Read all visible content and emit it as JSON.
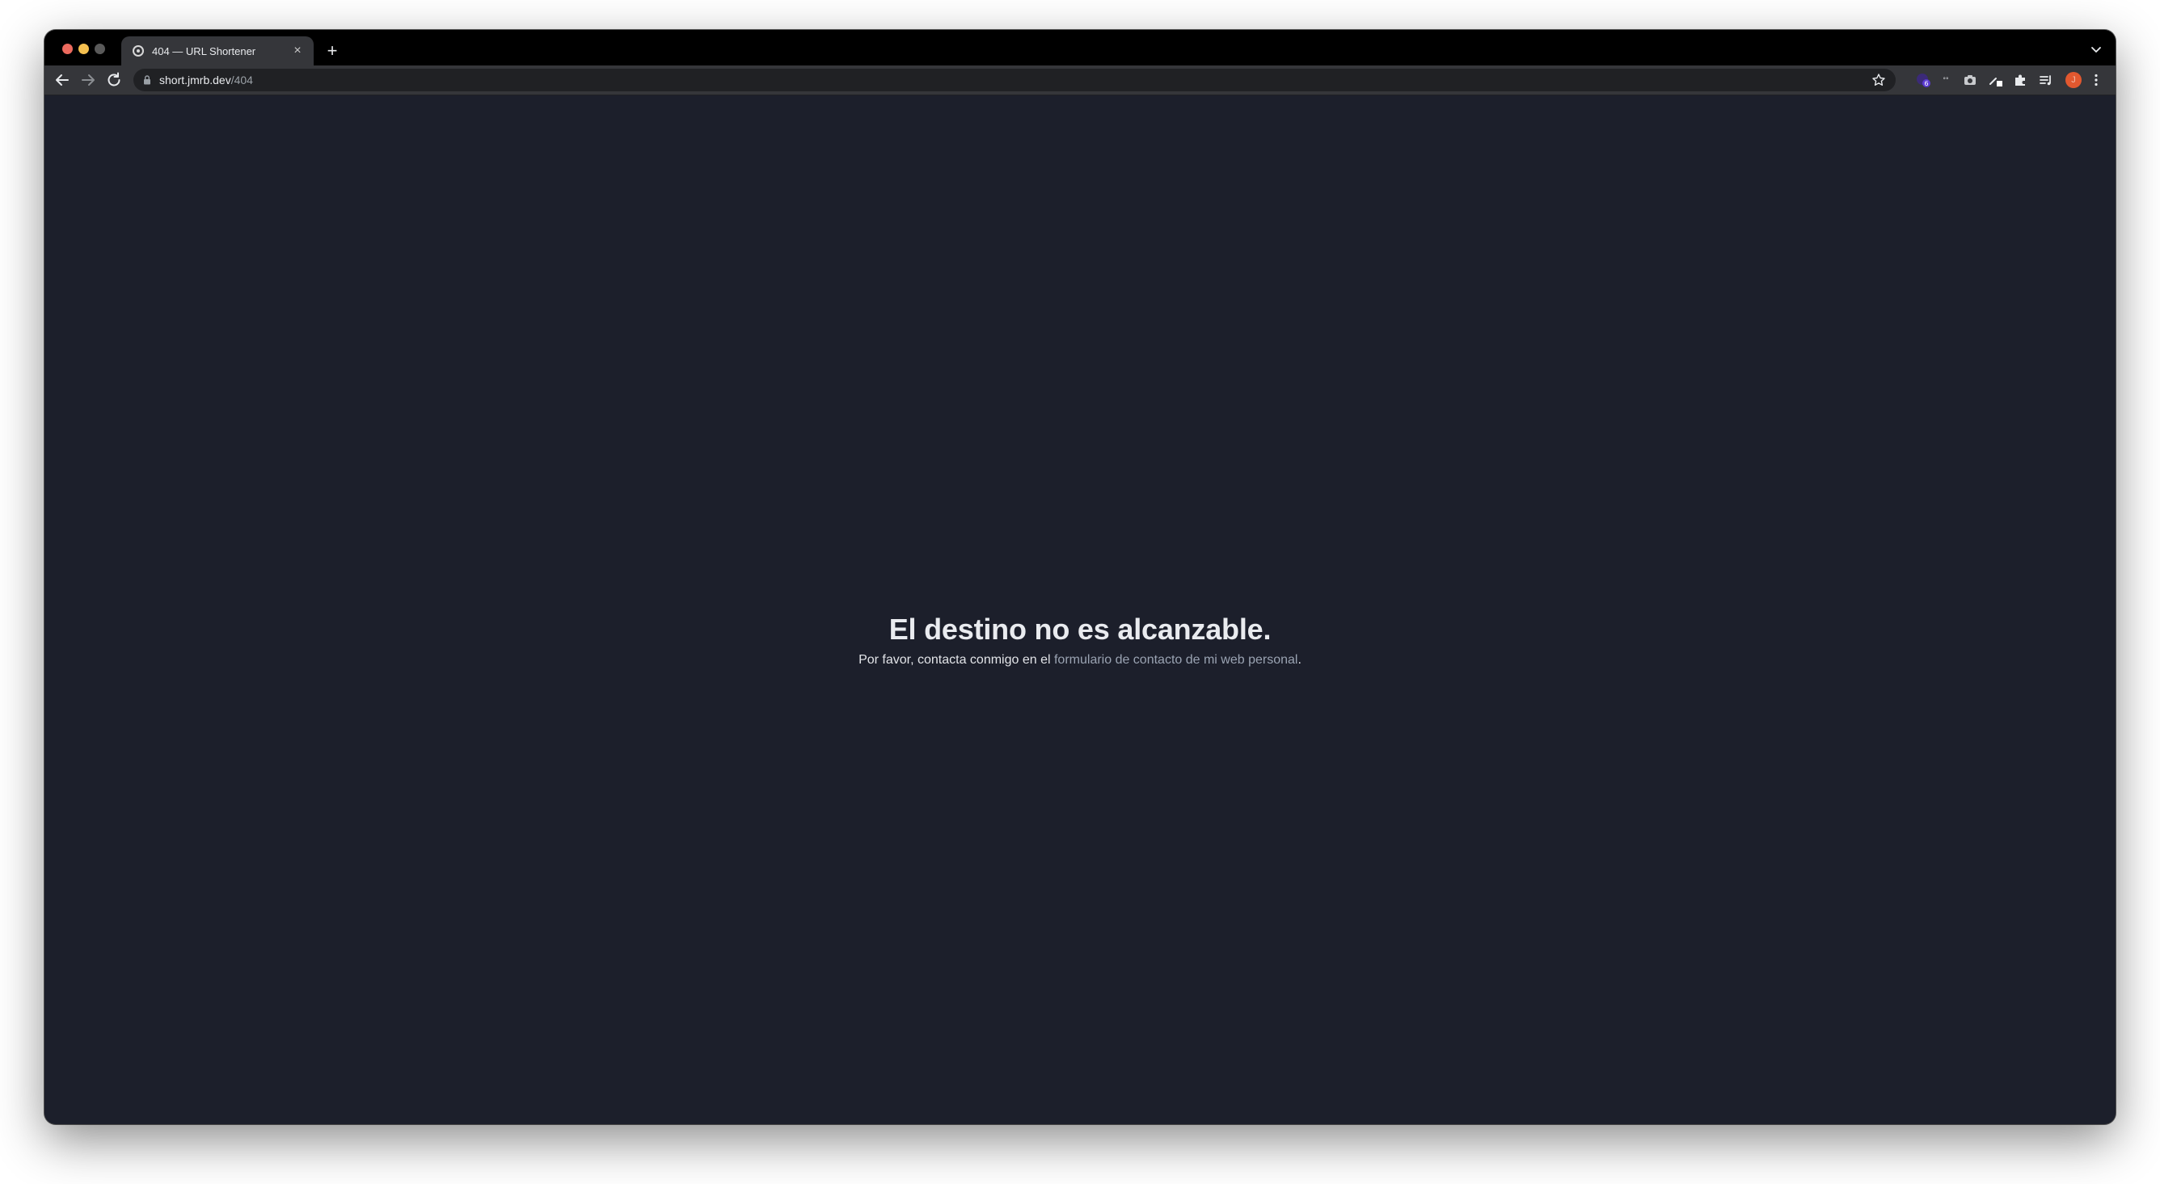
{
  "browser": {
    "tab": {
      "title": "404 — URL Shortener",
      "close_glyph": "×",
      "favicon": "globe-icon"
    },
    "new_tab_glyph": "+",
    "address": {
      "host": "short.jmrb.dev",
      "path": "/404"
    },
    "extensions": {
      "badge_count": "6",
      "small_label": "°°"
    },
    "profile_initial": "J"
  },
  "page": {
    "heading": "El destino no es alcanzable.",
    "message_prefix": "Por favor, contacta conmigo en el ",
    "link_text": "formulario de contacto de mi web personal",
    "message_suffix": "."
  },
  "colors": {
    "page_background": "#1c1f2b",
    "link": "#9aa3b2",
    "profile_avatar": "#e2582f"
  }
}
